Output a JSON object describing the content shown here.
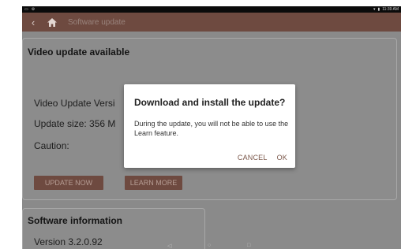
{
  "status_bar": {
    "left_icons": [
      "cast-icon",
      "gear-icon"
    ],
    "time": "11:39 AM"
  },
  "app_bar": {
    "back_icon": "chevron-left-icon",
    "home_icon": "home-icon",
    "title": "Software update"
  },
  "video_card": {
    "title": "Video update available",
    "version_label": "Video Update Versi",
    "size_label": "Update size: 356 M",
    "caution_label": "Caution:",
    "update_now": "UPDATE NOW",
    "learn_more": "LEARN MORE"
  },
  "software_card": {
    "title": "Software information",
    "version": "Version 3.2.0.92"
  },
  "dialog": {
    "title": "Download and install the update?",
    "body": "During the update, you will not be able to use the Learn feature.",
    "cancel": "CANCEL",
    "ok": "OK"
  },
  "nav_bar": {
    "back_glyph": "◁",
    "home_glyph": "○",
    "recents_glyph": "□"
  },
  "colors": {
    "accent": "#6e4a40",
    "dialog_button": "#7a5649",
    "scrim": "#8a8a8a"
  }
}
